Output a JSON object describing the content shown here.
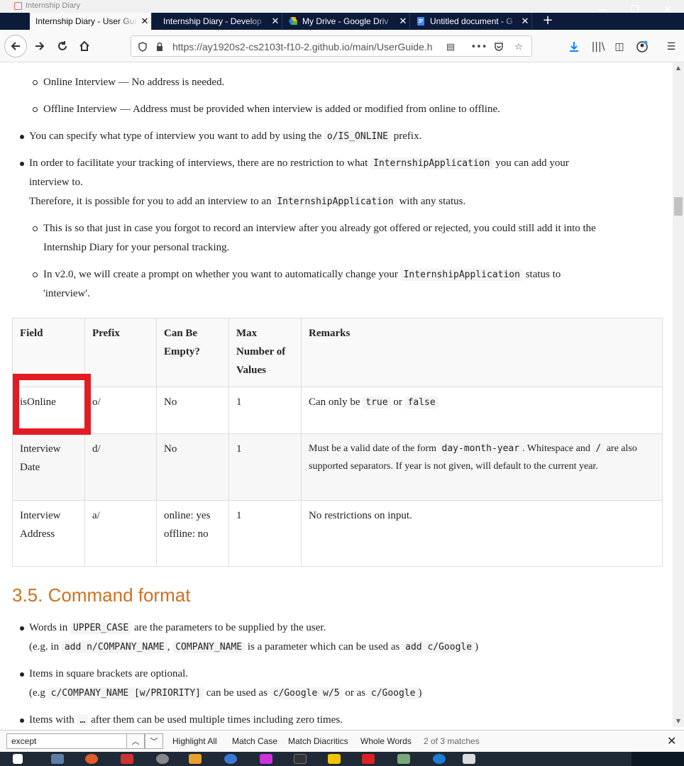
{
  "window": {
    "title": "Internship Diary"
  },
  "tabs": [
    {
      "label": "Internship Diary - User Gui",
      "active": true
    },
    {
      "label": "Internship Diary - Develop",
      "active": false
    },
    {
      "label": "My Drive - Google Driv",
      "active": false
    },
    {
      "label": "Untitled document - G",
      "active": false
    }
  ],
  "nav": {
    "url": "https://ay1920s2-cs2103t-f10-2.github.io/main/UserGuide.h"
  },
  "page": {
    "sub_bullets_top": [
      "Online Interview — No address is needed.",
      "Offline Interview — Address must be provided when interview is added or modified from online to offline."
    ],
    "bullet1": {
      "pre": "You can specify what type of interview you want to add by using the",
      "code": "o/IS_ONLINE",
      "post": "prefix."
    },
    "bullet2": {
      "pre": "In order to facilitate your tracking of interviews, there are no restriction to what",
      "code": "InternshipApplication",
      "post": "you can add your",
      "line2": "interview to.",
      "line3_pre": "Therefore, it is possible for you to add an interview to an",
      "line3_code": "InternshipApplication",
      "line3_post": "with any status."
    },
    "sub_bullet3": {
      "line1": "This is so that just in case you forgot to record an interview after you already got offered or rejected, you could still add it into the",
      "line2": "Internship Diary for your personal tracking."
    },
    "sub_bullet4": {
      "pre": "In v2.0, we will create a prompt on whether you want to automatically change your",
      "code": "InternshipApplication",
      "post": "status to",
      "line2": "'interview'."
    },
    "table": {
      "headers": [
        "Field",
        "Prefix",
        "Can Be Empty?",
        "Max Number of Values",
        "Remarks"
      ],
      "rows": [
        {
          "field": "isOnline",
          "prefix": "o/",
          "empty": "No",
          "max": "1",
          "remarks_pre": "Can only be",
          "remarks_code1": "true",
          "remarks_mid": "or",
          "remarks_code2": "false"
        },
        {
          "field": "Interview Date",
          "prefix": "d/",
          "empty": "No",
          "max": "1",
          "remarks_pre": "Must be a valid date of the form",
          "remarks_code1": "day-month-year",
          "remarks_mid": ". Whitespace and",
          "remarks_code2": "/",
          "remarks_post": "are also supported separators. If year is not given, will default to the current year."
        },
        {
          "field": "Interview Address",
          "prefix": "a/",
          "empty": "online: yes offline: no",
          "max": "1",
          "remarks_pre": "No restrictions on input."
        }
      ]
    },
    "section_heading": "3.5. Command format",
    "format_bullets": {
      "b1_pre": "Words in",
      "b1_code": "UPPER_CASE",
      "b1_post": "are the parameters to be supplied by the user.",
      "b1_l2_pre": "(e.g. in",
      "b1_l2_code1": "add n/COMPANY_NAME",
      "b1_l2_sep": ",",
      "b1_l2_code2": "COMPANY_NAME",
      "b1_l2_mid": "is a parameter which can be used as",
      "b1_l2_code3": "add c/Google",
      "b1_l2_post": ")",
      "b2": "Items in square brackets are optional.",
      "b2_l2_pre": "(e.g",
      "b2_l2_code1": "c/COMPANY_NAME [w/PRIORITY]",
      "b2_l2_mid": "can be used as",
      "b2_l2_code2": "c/Google w/5",
      "b2_l2_mid2": "or as",
      "b2_l2_code3": "c/Google",
      "b2_l2_post": ")",
      "b3_pre": "Items with",
      "b3_code": "…",
      "b3_post": "after them can be used multiple times including zero times."
    }
  },
  "findbar": {
    "query": "except",
    "highlight_all": "Highlight All",
    "match_case": "Match Case",
    "match_diacritics": "Match Diacritics",
    "whole_words": "Whole Words",
    "status": "2 of 3 matches"
  },
  "colors": {
    "tabbar": "#0c1b3a",
    "heading": "#d0701e",
    "highlight": "#e31b23"
  }
}
